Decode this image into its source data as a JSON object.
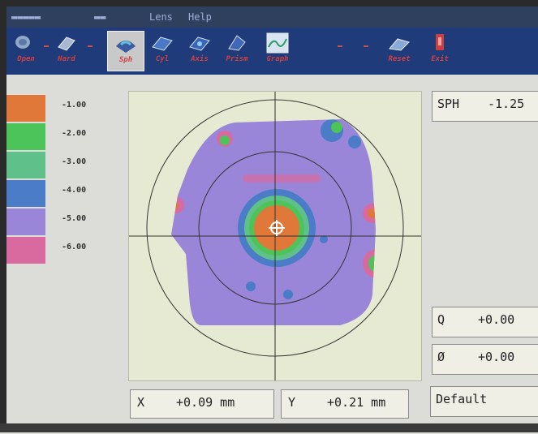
{
  "menu": {
    "left_item": "▬▬▬▬▬",
    "items": [
      "▬▬",
      "Lens",
      "Help"
    ]
  },
  "toolbar": {
    "buttons": [
      {
        "label": "Open"
      },
      {
        "label": "Hard"
      },
      {
        "label": "Sph"
      },
      {
        "label": "Cyl"
      },
      {
        "label": "Axis"
      },
      {
        "label": "Prism"
      },
      {
        "label": "Graph"
      },
      {
        "label": "Reset"
      },
      {
        "label": "Exit"
      }
    ],
    "colors": {
      "bg": "#1f3b7a",
      "label": "#d04040"
    }
  },
  "legend": {
    "items": [
      {
        "label": "-1.00",
        "color": "#e0783a"
      },
      {
        "label": "-2.00",
        "color": "#4cc45a"
      },
      {
        "label": "-3.00",
        "color": "#5fc08a"
      },
      {
        "label": "-4.00",
        "color": "#4a7cc8"
      },
      {
        "label": "-5.00",
        "color": "#9a86d8"
      },
      {
        "label": "-6.00",
        "color": "#d86aa0"
      }
    ]
  },
  "readouts": {
    "sph_label": "SPH",
    "sph_value": "-1.25",
    "q_label": "Q",
    "q_value": "+0.00",
    "phi_label": "Ø",
    "phi_value": "+0.00",
    "profile": "Default"
  },
  "cursor": {
    "x_label": "X",
    "x_value": "+0.09 mm",
    "y_label": "Y",
    "y_value": "+0.21 mm"
  }
}
